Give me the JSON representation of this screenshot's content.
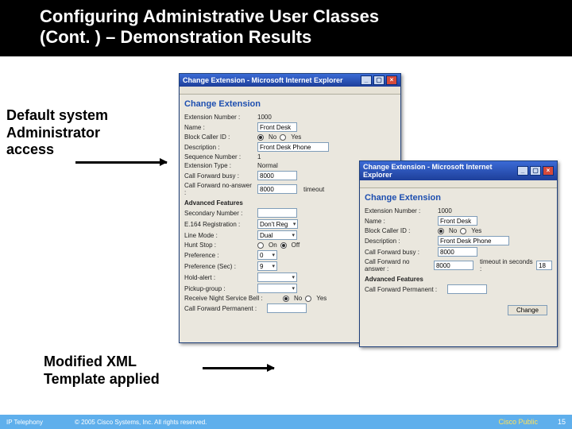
{
  "slide": {
    "title_line1": "Configuring Administrative User Classes",
    "title_line2": "(Cont. ) – Demonstration Results",
    "annot1_l1": "Default system",
    "annot1_l2": "Administrator",
    "annot1_l3": "access",
    "annot2_l1": "Modified XML",
    "annot2_l2": "Template applied"
  },
  "winA": {
    "title": "Change Extension - Microsoft Internet Explorer",
    "header": "Change Extension",
    "rows": {
      "ext_lbl": "Extension Number :",
      "ext_val": "1000",
      "name_lbl": "Name :",
      "name_val": "Front Desk",
      "bcid_lbl": "Block Caller ID :",
      "bcid_no": "No",
      "bcid_yes": "Yes",
      "desc_lbl": "Description :",
      "desc_val": "Front Desk Phone",
      "seq_lbl": "Sequence Number :",
      "seq_val": "1",
      "etype_lbl": "Extension Type :",
      "etype_val": "Normal",
      "cfb_lbl": "Call Forward busy :",
      "cfb_val": "8000",
      "cfna_lbl": "Call Forward no-answer :",
      "cfna_val": "8000",
      "cfna_extra": "timeout"
    },
    "adv_hdr": "Advanced Features",
    "adv": {
      "sec_lbl": "Secondary Number :",
      "sec_val": "",
      "e164_lbl": "E.164 Registration :",
      "e164_val": "Don't Reg",
      "lm_lbl": "Line Mode :",
      "lm_val": "Dual",
      "hs_lbl": "Hunt Stop :",
      "hs_on": "On",
      "hs_off": "Off",
      "pref_lbl": "Preference :",
      "pref_val": "0",
      "prefs_lbl": "Preference (Sec) :",
      "prefs_val": "9",
      "hold_lbl": "Hold-alert :",
      "hold_val": "",
      "pg_lbl": "Pickup-group :",
      "pg_val": "",
      "rns_lbl": "Receive Night Service Bell :",
      "rns_no": "No",
      "rns_yes": "Yes",
      "cfp_lbl": "Call Forward Permanent :",
      "cfp_val": ""
    }
  },
  "winB": {
    "title": "Change Extension - Microsoft Internet Explorer",
    "header": "Change Extension",
    "rows": {
      "ext_lbl": "Extension Number :",
      "ext_val": "1000",
      "name_lbl": "Name :",
      "name_val": "Front Desk",
      "bcid_lbl": "Block Caller ID :",
      "bcid_no": "No",
      "bcid_yes": "Yes",
      "desc_lbl": "Description :",
      "desc_val": "Front Desk Phone",
      "cfb_lbl": "Call Forward busy :",
      "cfb_val": "8000",
      "cfna_lbl": "Call Forward no answer :",
      "cfna_val": "8000",
      "to_lbl": "timeout in seconds :",
      "to_val": "18"
    },
    "adv_hdr": "Advanced Features",
    "adv": {
      "cfp_lbl": "Call Forward Permanent :",
      "cfp_val": ""
    },
    "change_btn": "Change"
  },
  "footer": {
    "left": "IP Telephony",
    "copyright": "© 2005 Cisco Systems, Inc. All rights reserved.",
    "brand": "Cisco Public",
    "page": "15"
  }
}
